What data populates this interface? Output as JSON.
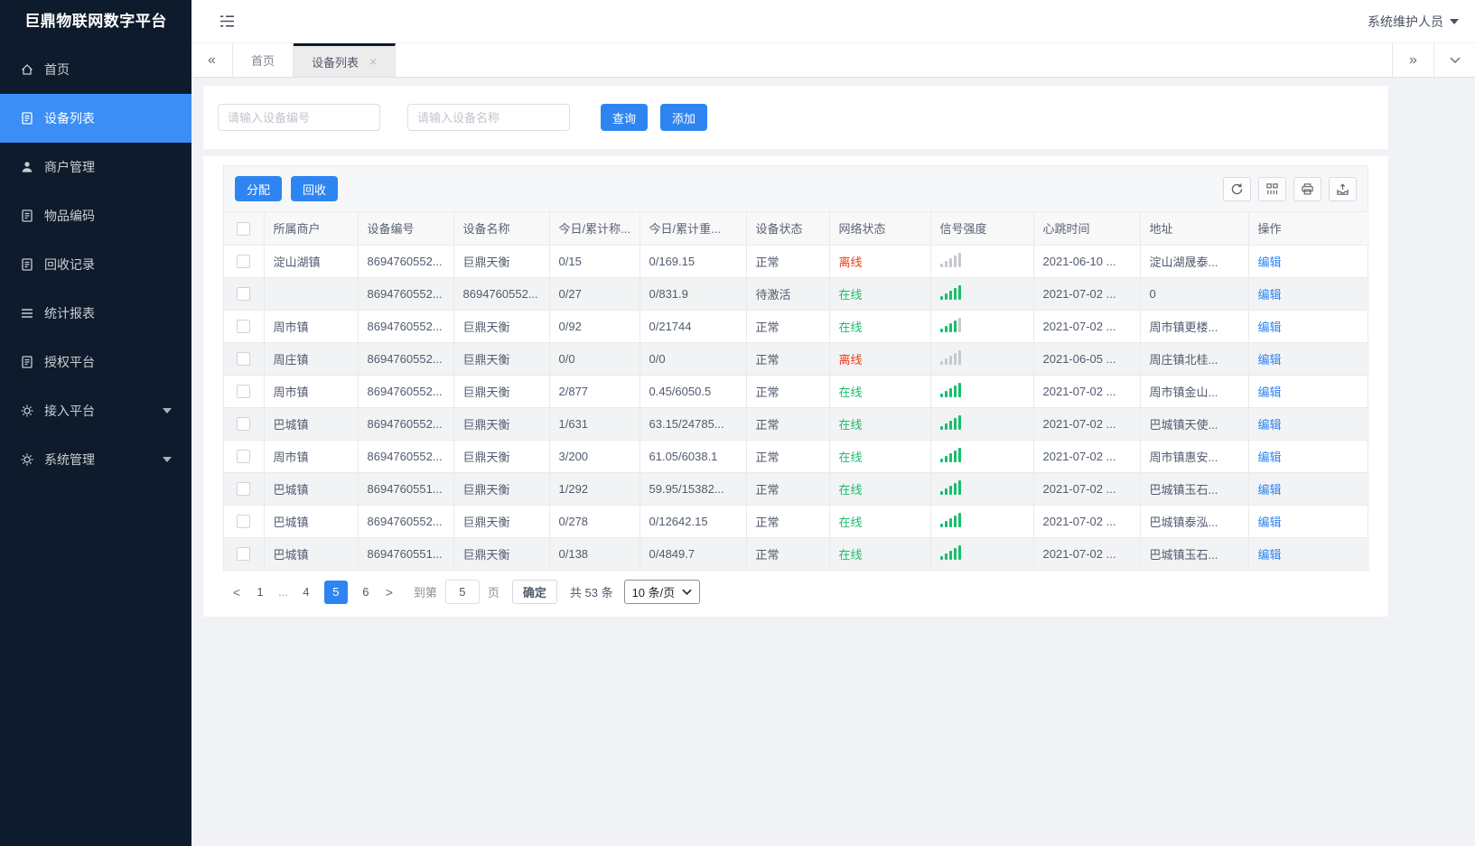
{
  "app": {
    "title": "巨鼎物联网数字平台",
    "user": "系统维护人员"
  },
  "sidebar": {
    "items": [
      {
        "label": "首页",
        "icon": "home-icon",
        "active": false
      },
      {
        "label": "设备列表",
        "icon": "document-icon",
        "active": true
      },
      {
        "label": "商户管理",
        "icon": "user-icon",
        "active": false
      },
      {
        "label": "物品编码",
        "icon": "document-icon",
        "active": false
      },
      {
        "label": "回收记录",
        "icon": "document-icon",
        "active": false
      },
      {
        "label": "统计报表",
        "icon": "list-icon",
        "active": false
      },
      {
        "label": "授权平台",
        "icon": "document-icon",
        "active": false
      },
      {
        "label": "接入平台",
        "icon": "gear-icon",
        "active": false,
        "expandable": true
      },
      {
        "label": "系统管理",
        "icon": "gear-icon",
        "active": false,
        "expandable": true
      }
    ]
  },
  "tabs": {
    "back": "«",
    "forward": "»",
    "close": "×",
    "items": [
      {
        "label": "首页",
        "active": false
      },
      {
        "label": "设备列表",
        "active": true
      }
    ]
  },
  "search": {
    "device_no_placeholder": "请输入设备编号",
    "device_name_placeholder": "请输入设备名称",
    "query_label": "查询",
    "add_label": "添加"
  },
  "toolbar": {
    "assign_label": "分配",
    "recycle_label": "回收",
    "icons": [
      "refresh-icon",
      "columns-icon",
      "print-icon",
      "export-icon"
    ]
  },
  "table": {
    "columns": [
      "所属商户",
      "设备编号",
      "设备名称",
      "今日/累计称...",
      "今日/累计重...",
      "设备状态",
      "网络状态",
      "信号强度",
      "心跳时间",
      "地址",
      "操作"
    ],
    "rows": [
      {
        "merchant": "淀山湖镇",
        "device_no": "8694760552...",
        "device_name": "巨鼎天衡",
        "today_count": "0/15",
        "today_weight": "0/169.15",
        "device_status": "正常",
        "network_status": "离线",
        "network_online": false,
        "signal": 0,
        "heartbeat": "2021-06-10 ...",
        "address": "淀山湖晟泰...",
        "action": "编辑"
      },
      {
        "merchant": "",
        "device_no": "8694760552...",
        "device_name": "8694760552...",
        "today_count": "0/27",
        "today_weight": "0/831.9",
        "device_status": "待激活",
        "network_status": "在线",
        "network_online": true,
        "signal": 5,
        "heartbeat": "2021-07-02 ...",
        "address": "0",
        "action": "编辑"
      },
      {
        "merchant": "周市镇",
        "device_no": "8694760552...",
        "device_name": "巨鼎天衡",
        "today_count": "0/92",
        "today_weight": "0/21744",
        "device_status": "正常",
        "network_status": "在线",
        "network_online": true,
        "signal": 4,
        "heartbeat": "2021-07-02 ...",
        "address": "周市镇更楼...",
        "action": "编辑"
      },
      {
        "merchant": "周庄镇",
        "device_no": "8694760552...",
        "device_name": "巨鼎天衡",
        "today_count": "0/0",
        "today_weight": "0/0",
        "device_status": "正常",
        "network_status": "离线",
        "network_online": false,
        "signal": 0,
        "heartbeat": "2021-06-05 ...",
        "address": "周庄镇北桂...",
        "action": "编辑"
      },
      {
        "merchant": "周市镇",
        "device_no": "8694760552...",
        "device_name": "巨鼎天衡",
        "today_count": "2/877",
        "today_weight": "0.45/6050.5",
        "device_status": "正常",
        "network_status": "在线",
        "network_online": true,
        "signal": 5,
        "heartbeat": "2021-07-02 ...",
        "address": "周市镇金山...",
        "action": "编辑"
      },
      {
        "merchant": "巴城镇",
        "device_no": "8694760552...",
        "device_name": "巨鼎天衡",
        "today_count": "1/631",
        "today_weight": "63.15/24785...",
        "device_status": "正常",
        "network_status": "在线",
        "network_online": true,
        "signal": 5,
        "heartbeat": "2021-07-02 ...",
        "address": "巴城镇天使...",
        "action": "编辑"
      },
      {
        "merchant": "周市镇",
        "device_no": "8694760552...",
        "device_name": "巨鼎天衡",
        "today_count": "3/200",
        "today_weight": "61.05/6038.1",
        "device_status": "正常",
        "network_status": "在线",
        "network_online": true,
        "signal": 5,
        "heartbeat": "2021-07-02 ...",
        "address": "周市镇惠安...",
        "action": "编辑"
      },
      {
        "merchant": "巴城镇",
        "device_no": "8694760551...",
        "device_name": "巨鼎天衡",
        "today_count": "1/292",
        "today_weight": "59.95/15382...",
        "device_status": "正常",
        "network_status": "在线",
        "network_online": true,
        "signal": 5,
        "heartbeat": "2021-07-02 ...",
        "address": "巴城镇玉石...",
        "action": "编辑"
      },
      {
        "merchant": "巴城镇",
        "device_no": "8694760552...",
        "device_name": "巨鼎天衡",
        "today_count": "0/278",
        "today_weight": "0/12642.15",
        "device_status": "正常",
        "network_status": "在线",
        "network_online": true,
        "signal": 5,
        "heartbeat": "2021-07-02 ...",
        "address": "巴城镇泰泓...",
        "action": "编辑"
      },
      {
        "merchant": "巴城镇",
        "device_no": "8694760551...",
        "device_name": "巨鼎天衡",
        "today_count": "0/138",
        "today_weight": "0/4849.7",
        "device_status": "正常",
        "network_status": "在线",
        "network_online": true,
        "signal": 5,
        "heartbeat": "2021-07-02 ...",
        "address": "巴城镇玉石...",
        "action": "编辑"
      }
    ]
  },
  "pagination": {
    "prev": "<",
    "next": ">",
    "pages": [
      "1",
      "...",
      "4",
      "5",
      "6"
    ],
    "active_page": "5",
    "goto_label": "到第",
    "jump_value": "5",
    "page_unit": "页",
    "confirm_label": "确定",
    "total_label": "共 53 条",
    "page_size": "10 条/页"
  },
  "colors": {
    "primary": "#2e85f2",
    "success": "#19be6b",
    "danger": "#ed3f14",
    "sidebar_bg": "#0d1b2c",
    "signal_off": "#c5c8ce"
  }
}
